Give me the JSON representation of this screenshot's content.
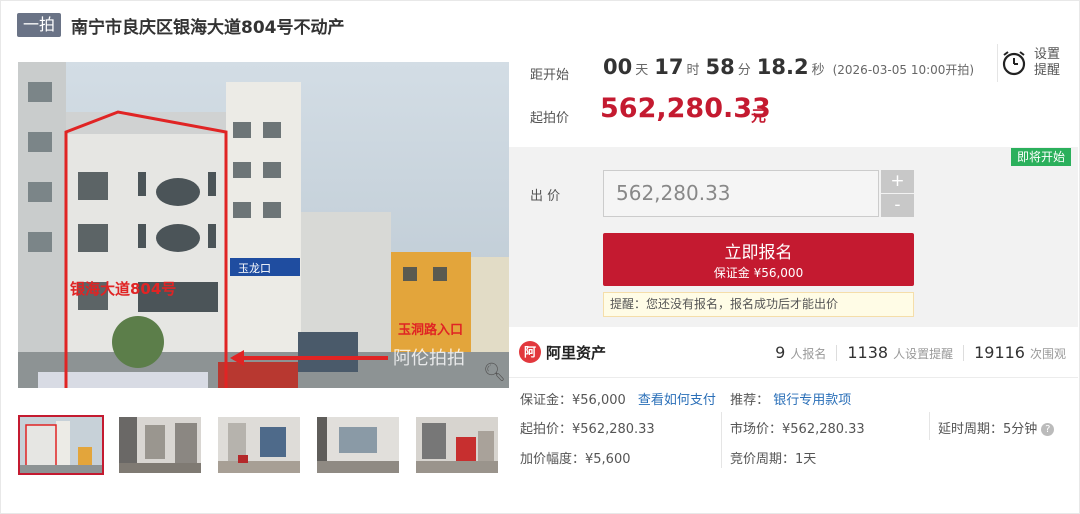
{
  "header": {
    "badge": "一拍",
    "title": "南宁市良庆区银海大道804号不动产"
  },
  "photo": {
    "overlay_texts": [
      "银海大道804号",
      "玉龙口",
      "玉洞路入口"
    ],
    "watermark": "阿伦拍拍",
    "zoom_icon": "magnifier-icon",
    "thumbnails": [
      {
        "scene": "building-exterior",
        "active": true
      },
      {
        "scene": "interior-door",
        "active": false
      },
      {
        "scene": "interior-room",
        "active": false
      },
      {
        "scene": "interior-window",
        "active": false
      },
      {
        "scene": "interior-red-chair",
        "active": false
      }
    ]
  },
  "countdown": {
    "label": "距开始",
    "days": "00",
    "days_unit": "天",
    "hours": "17",
    "hours_unit": "时",
    "minutes": "58",
    "minutes_unit": "分",
    "seconds": "18.2",
    "seconds_unit": "秒",
    "note": "(2026-03-05 10:00开拍)"
  },
  "remind": {
    "label_line1": "设置",
    "label_line2": "提醒",
    "icon": "alarm-clock-icon"
  },
  "start_price": {
    "label": "起拍价",
    "value": "562,280.33",
    "unit": "元"
  },
  "bid": {
    "status_badge": "即将开始",
    "label": "出 价",
    "value": "562,280.33",
    "plus": "+",
    "minus": "-",
    "signup_label": "立即报名",
    "signup_deposit": "保证金 ¥56,000",
    "tip": "提醒：您还没有报名，报名成功后才能出价"
  },
  "platform": {
    "logo_glyph": "阿",
    "name": "阿里资产"
  },
  "stats": {
    "signups": "9",
    "signups_label": "人报名",
    "reminders": "1138",
    "reminders_label": "人设置提醒",
    "views": "19116",
    "views_label": "次围观"
  },
  "info": {
    "deposit": "保证金：¥56,000",
    "how_to_pay": "查看如何支付",
    "recommend_label": "推荐：",
    "recommend_link": "银行专用款项",
    "start_price": "起拍价：¥562,280.33",
    "market_price": "市场价：¥562,280.33",
    "delay_period": "延时周期：5分钟",
    "increment": "加价幅度：¥5,600",
    "bid_period": "竞价周期：1天"
  },
  "colors": {
    "accent": "#c41a30",
    "badge": "#6a7386",
    "status_green": "#2bb05c",
    "link": "#2a6fb8"
  }
}
